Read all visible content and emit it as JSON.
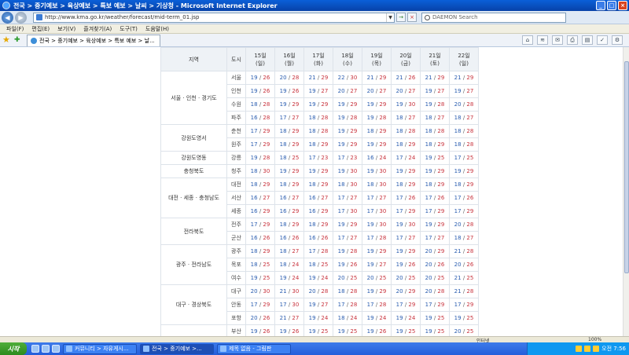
{
  "window": {
    "title": "전국 > 중기예보 > 육상예보 > 특보 예보 > 날씨 > 기상청 - Microsoft Internet Explorer",
    "min": "_",
    "max": "□",
    "close": "×"
  },
  "nav": {
    "back": "◀",
    "forward": "▶",
    "address": "http://www.kma.go.kr/weather/forecast/mid-term_01.jsp",
    "go": "→",
    "stop": "×",
    "search_placeholder": "DAEMON Search"
  },
  "menu": [
    "파일(F)",
    "편집(E)",
    "보기(V)",
    "즐겨찾기(A)",
    "도구(T)",
    "도움말(H)"
  ],
  "tab": {
    "label": "전국 > 중기예보 > 육상예보 > 특보 예보 > 날..."
  },
  "toolbar_icons": [
    "home-icon",
    "feeds-icon",
    "mail-icon",
    "print-icon",
    "page-icon",
    "safety-icon",
    "tools-icon"
  ],
  "table": {
    "headers": {
      "region": "지역",
      "city": "도시",
      "days": [
        {
          "date": "15일",
          "dow": "(일)"
        },
        {
          "date": "16일",
          "dow": "(월)"
        },
        {
          "date": "17일",
          "dow": "(화)"
        },
        {
          "date": "18일",
          "dow": "(수)"
        },
        {
          "date": "19일",
          "dow": "(목)"
        },
        {
          "date": "20일",
          "dow": "(금)"
        },
        {
          "date": "21일",
          "dow": "(토)"
        },
        {
          "date": "22일",
          "dow": "(일)"
        }
      ]
    },
    "groups": [
      {
        "region": "서울 · 인천 · 경기도",
        "rows": [
          {
            "city": "서울",
            "temps": [
              [
                "19",
                "26"
              ],
              [
                "20",
                "28"
              ],
              [
                "21",
                "29"
              ],
              [
                "22",
                "30"
              ],
              [
                "21",
                "29"
              ],
              [
                "21",
                "26"
              ],
              [
                "21",
                "29"
              ],
              [
                "21",
                "29"
              ]
            ]
          },
          {
            "city": "인천",
            "temps": [
              [
                "19",
                "26"
              ],
              [
                "19",
                "26"
              ],
              [
                "19",
                "27"
              ],
              [
                "20",
                "27"
              ],
              [
                "20",
                "27"
              ],
              [
                "20",
                "27"
              ],
              [
                "19",
                "27"
              ],
              [
                "19",
                "27"
              ]
            ]
          },
          {
            "city": "수원",
            "temps": [
              [
                "18",
                "28"
              ],
              [
                "19",
                "29"
              ],
              [
                "19",
                "29"
              ],
              [
                "19",
                "29"
              ],
              [
                "19",
                "29"
              ],
              [
                "19",
                "30"
              ],
              [
                "19",
                "28"
              ],
              [
                "20",
                "28"
              ]
            ]
          },
          {
            "city": "파주",
            "temps": [
              [
                "16",
                "28"
              ],
              [
                "17",
                "27"
              ],
              [
                "18",
                "28"
              ],
              [
                "19",
                "28"
              ],
              [
                "19",
                "28"
              ],
              [
                "18",
                "27"
              ],
              [
                "18",
                "27"
              ],
              [
                "18",
                "27"
              ]
            ]
          }
        ]
      },
      {
        "region": "강원도영서",
        "rows": [
          {
            "city": "춘천",
            "temps": [
              [
                "17",
                "29"
              ],
              [
                "18",
                "29"
              ],
              [
                "18",
                "28"
              ],
              [
                "19",
                "29"
              ],
              [
                "18",
                "29"
              ],
              [
                "18",
                "28"
              ],
              [
                "18",
                "28"
              ],
              [
                "18",
                "28"
              ]
            ]
          },
          {
            "city": "원주",
            "temps": [
              [
                "17",
                "29"
              ],
              [
                "18",
                "29"
              ],
              [
                "18",
                "29"
              ],
              [
                "19",
                "29"
              ],
              [
                "19",
                "29"
              ],
              [
                "18",
                "29"
              ],
              [
                "18",
                "29"
              ],
              [
                "18",
                "28"
              ]
            ]
          }
        ]
      },
      {
        "region": "강원도영동",
        "rows": [
          {
            "city": "강릉",
            "temps": [
              [
                "19",
                "28"
              ],
              [
                "18",
                "25"
              ],
              [
                "17",
                "23"
              ],
              [
                "17",
                "23"
              ],
              [
                "16",
                "24"
              ],
              [
                "17",
                "24"
              ],
              [
                "19",
                "25"
              ],
              [
                "17",
                "25"
              ]
            ]
          }
        ]
      },
      {
        "region": "충청북도",
        "rows": [
          {
            "city": "청주",
            "temps": [
              [
                "18",
                "30"
              ],
              [
                "19",
                "29"
              ],
              [
                "19",
                "29"
              ],
              [
                "19",
                "30"
              ],
              [
                "19",
                "30"
              ],
              [
                "19",
                "29"
              ],
              [
                "19",
                "29"
              ],
              [
                "19",
                "29"
              ]
            ]
          }
        ]
      },
      {
        "region": "대전 · 세종 · 충청남도",
        "rows": [
          {
            "city": "대전",
            "temps": [
              [
                "18",
                "29"
              ],
              [
                "18",
                "29"
              ],
              [
                "18",
                "29"
              ],
              [
                "18",
                "30"
              ],
              [
                "18",
                "30"
              ],
              [
                "18",
                "29"
              ],
              [
                "18",
                "29"
              ],
              [
                "18",
                "29"
              ]
            ]
          },
          {
            "city": "서산",
            "temps": [
              [
                "16",
                "27"
              ],
              [
                "16",
                "27"
              ],
              [
                "16",
                "27"
              ],
              [
                "17",
                "27"
              ],
              [
                "17",
                "27"
              ],
              [
                "17",
                "26"
              ],
              [
                "17",
                "26"
              ],
              [
                "17",
                "26"
              ]
            ]
          },
          {
            "city": "세종",
            "temps": [
              [
                "16",
                "29"
              ],
              [
                "16",
                "29"
              ],
              [
                "16",
                "29"
              ],
              [
                "17",
                "30"
              ],
              [
                "17",
                "30"
              ],
              [
                "17",
                "29"
              ],
              [
                "17",
                "29"
              ],
              [
                "17",
                "29"
              ]
            ]
          }
        ]
      },
      {
        "region": "전라북도",
        "rows": [
          {
            "city": "전주",
            "temps": [
              [
                "17",
                "29"
              ],
              [
                "18",
                "29"
              ],
              [
                "18",
                "29"
              ],
              [
                "19",
                "29"
              ],
              [
                "19",
                "30"
              ],
              [
                "19",
                "30"
              ],
              [
                "19",
                "29"
              ],
              [
                "20",
                "28"
              ]
            ]
          },
          {
            "city": "군산",
            "temps": [
              [
                "16",
                "26"
              ],
              [
                "16",
                "26"
              ],
              [
                "16",
                "26"
              ],
              [
                "17",
                "27"
              ],
              [
                "17",
                "28"
              ],
              [
                "17",
                "27"
              ],
              [
                "17",
                "27"
              ],
              [
                "18",
                "27"
              ]
            ]
          }
        ]
      },
      {
        "region": "광주 · 전라남도",
        "rows": [
          {
            "city": "광주",
            "temps": [
              [
                "18",
                "29"
              ],
              [
                "18",
                "27"
              ],
              [
                "17",
                "28"
              ],
              [
                "19",
                "28"
              ],
              [
                "19",
                "29"
              ],
              [
                "19",
                "29"
              ],
              [
                "20",
                "29"
              ],
              [
                "21",
                "28"
              ]
            ]
          },
          {
            "city": "목포",
            "temps": [
              [
                "18",
                "25"
              ],
              [
                "18",
                "24"
              ],
              [
                "18",
                "25"
              ],
              [
                "19",
                "26"
              ],
              [
                "19",
                "27"
              ],
              [
                "19",
                "26"
              ],
              [
                "20",
                "26"
              ],
              [
                "20",
                "26"
              ]
            ]
          },
          {
            "city": "여수",
            "temps": [
              [
                "19",
                "25"
              ],
              [
                "19",
                "24"
              ],
              [
                "19",
                "24"
              ],
              [
                "20",
                "25"
              ],
              [
                "20",
                "25"
              ],
              [
                "20",
                "25"
              ],
              [
                "20",
                "25"
              ],
              [
                "21",
                "25"
              ]
            ]
          }
        ]
      },
      {
        "region": "대구 · 경상북도",
        "rows": [
          {
            "city": "대구",
            "temps": [
              [
                "20",
                "30"
              ],
              [
                "21",
                "30"
              ],
              [
                "20",
                "28"
              ],
              [
                "18",
                "28"
              ],
              [
                "19",
                "29"
              ],
              [
                "20",
                "29"
              ],
              [
                "20",
                "28"
              ],
              [
                "21",
                "28"
              ]
            ]
          },
          {
            "city": "안동",
            "temps": [
              [
                "17",
                "29"
              ],
              [
                "17",
                "30"
              ],
              [
                "19",
                "27"
              ],
              [
                "17",
                "28"
              ],
              [
                "17",
                "28"
              ],
              [
                "17",
                "29"
              ],
              [
                "17",
                "29"
              ],
              [
                "17",
                "29"
              ]
            ]
          },
          {
            "city": "포항",
            "temps": [
              [
                "20",
                "26"
              ],
              [
                "21",
                "27"
              ],
              [
                "19",
                "24"
              ],
              [
                "18",
                "24"
              ],
              [
                "19",
                "24"
              ],
              [
                "19",
                "24"
              ],
              [
                "19",
                "25"
              ],
              [
                "19",
                "25"
              ]
            ]
          }
        ]
      },
      {
        "region": "",
        "rows": [
          {
            "city": "부산",
            "temps": [
              [
                "19",
                "26"
              ],
              [
                "19",
                "26"
              ],
              [
                "19",
                "25"
              ],
              [
                "19",
                "25"
              ],
              [
                "19",
                "26"
              ],
              [
                "19",
                "25"
              ],
              [
                "19",
                "25"
              ],
              [
                "20",
                "25"
              ]
            ]
          }
        ]
      }
    ]
  },
  "statusbar": {
    "zone": "인터넷",
    "zoom": "100%"
  },
  "taskbar": {
    "start": "시작",
    "tasks": [
      {
        "label": "커뮤니티 > 자유게시..."
      },
      {
        "label": "전국 > 중기예보 >..."
      },
      {
        "label": "제목 없음 - 그림판"
      }
    ],
    "clock": "오전 7:56"
  }
}
